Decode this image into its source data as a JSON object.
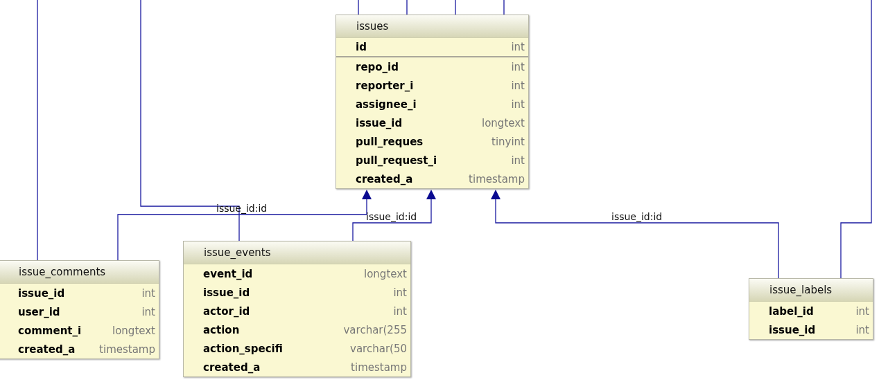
{
  "tables": [
    {
      "name": "issues",
      "columns": [
        {
          "name": "id",
          "type": "int",
          "key": true
        },
        {
          "name": "repo_id",
          "type": "int",
          "key": false
        },
        {
          "name": "reporter_i",
          "type": "int",
          "key": false
        },
        {
          "name": "assignee_i",
          "type": "int",
          "key": false
        },
        {
          "name": "issue_id",
          "type": "longtext",
          "key": false
        },
        {
          "name": "pull_reques",
          "type": "tinyint",
          "key": false
        },
        {
          "name": "pull_request_i",
          "type": "int",
          "key": false
        },
        {
          "name": "created_a",
          "type": "timestamp",
          "key": false
        }
      ]
    },
    {
      "name": "issue_comments",
      "columns": [
        {
          "name": "issue_id",
          "type": "int",
          "key": false
        },
        {
          "name": "user_id",
          "type": "int",
          "key": false
        },
        {
          "name": "comment_i",
          "type": "longtext",
          "key": false
        },
        {
          "name": "created_a",
          "type": "timestamp",
          "key": false
        }
      ]
    },
    {
      "name": "issue_events",
      "columns": [
        {
          "name": "event_id",
          "type": "longtext",
          "key": false
        },
        {
          "name": "issue_id",
          "type": "int",
          "key": false
        },
        {
          "name": "actor_id",
          "type": "int",
          "key": false
        },
        {
          "name": "action",
          "type": "varchar(255",
          "key": false
        },
        {
          "name": "action_specifi",
          "type": "varchar(50",
          "key": false
        },
        {
          "name": "created_a",
          "type": "timestamp",
          "key": false
        }
      ]
    },
    {
      "name": "issue_labels",
      "columns": [
        {
          "name": "label_id",
          "type": "int",
          "key": false
        },
        {
          "name": "issue_id",
          "type": "int",
          "key": false
        }
      ]
    }
  ],
  "relationships": [
    {
      "label": "issue_id:id"
    },
    {
      "label": "issue_id:id"
    },
    {
      "label": "issue_id:id"
    }
  ]
}
